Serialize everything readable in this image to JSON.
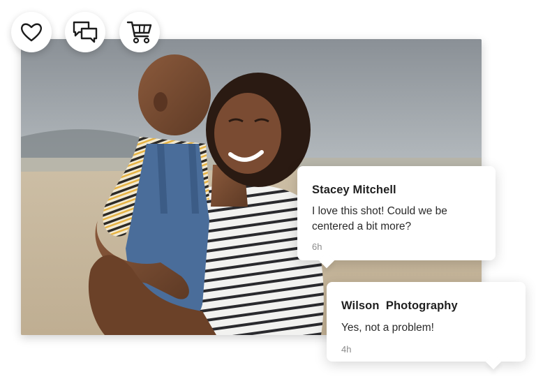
{
  "actions": {
    "like": {
      "icon": "heart-icon"
    },
    "comments": {
      "icon": "chat-bubbles-icon"
    },
    "cart": {
      "icon": "cart-icon"
    }
  },
  "photo": {
    "subject": "mother-and-child-photo"
  },
  "comments": [
    {
      "author": "Stacey Mitchell",
      "message": "I love this shot! Could we be centered a bit more?",
      "time": "6h"
    },
    {
      "author": "Wilson  Photography",
      "message": "Yes, not a problem!",
      "time": "4h"
    }
  ],
  "colors": {
    "text": "#1f1f1f",
    "muted": "#8a8a8a",
    "card": "#ffffff"
  }
}
